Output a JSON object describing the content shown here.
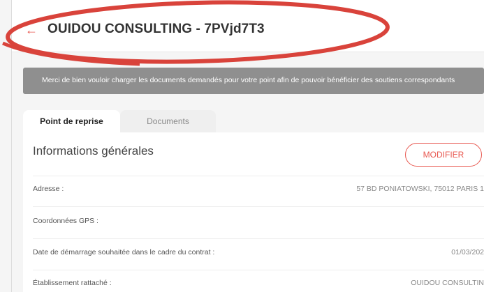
{
  "header": {
    "title": "OUIDOU CONSULTING - 7PVjd7T3",
    "back_icon": "arrow-left-icon",
    "accent": "#e8574f"
  },
  "notice": {
    "text": "Merci de bien vouloir charger les documents demandés pour votre point afin de pouvoir bénéficier des soutiens correspondants"
  },
  "tabs": [
    {
      "label": "Point de reprise",
      "active": true
    },
    {
      "label": "Documents",
      "active": false
    }
  ],
  "section": {
    "title": "Informations générales",
    "modify_label": "MODIFIER"
  },
  "info_rows": [
    {
      "label": "Adresse :",
      "value": "57 BD PONIATOWSKI, 75012 PARIS 1"
    },
    {
      "label": "Coordonnées GPS :",
      "value": ""
    },
    {
      "label": "Date de démarrage souhaitée dans le cadre du contrat :",
      "value": "01/03/202"
    },
    {
      "label": "Établissement rattaché :",
      "value": "OUIDOU CONSULTIN"
    }
  ],
  "annotation_color": "#d9433b"
}
